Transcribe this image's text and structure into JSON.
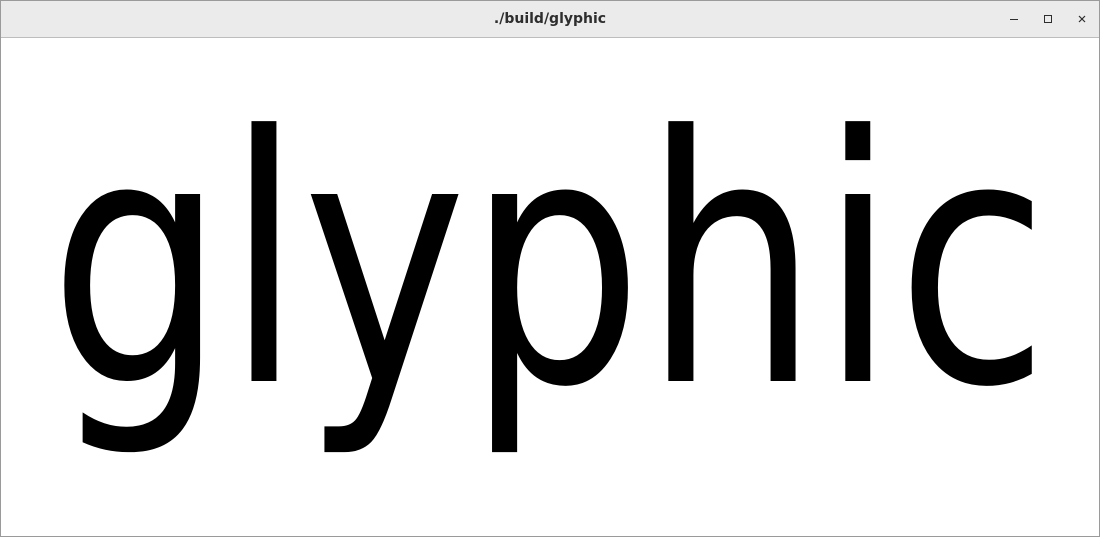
{
  "window": {
    "title": "./build/glyphic",
    "controls": [
      {
        "name": "minimize",
        "icon": "minimize-icon"
      },
      {
        "name": "maximize",
        "icon": "maximize-icon"
      },
      {
        "name": "close",
        "icon": "close-icon"
      }
    ]
  },
  "canvas": {
    "text": "glyphic",
    "text_color": "#000000",
    "background": "#ffffff"
  }
}
